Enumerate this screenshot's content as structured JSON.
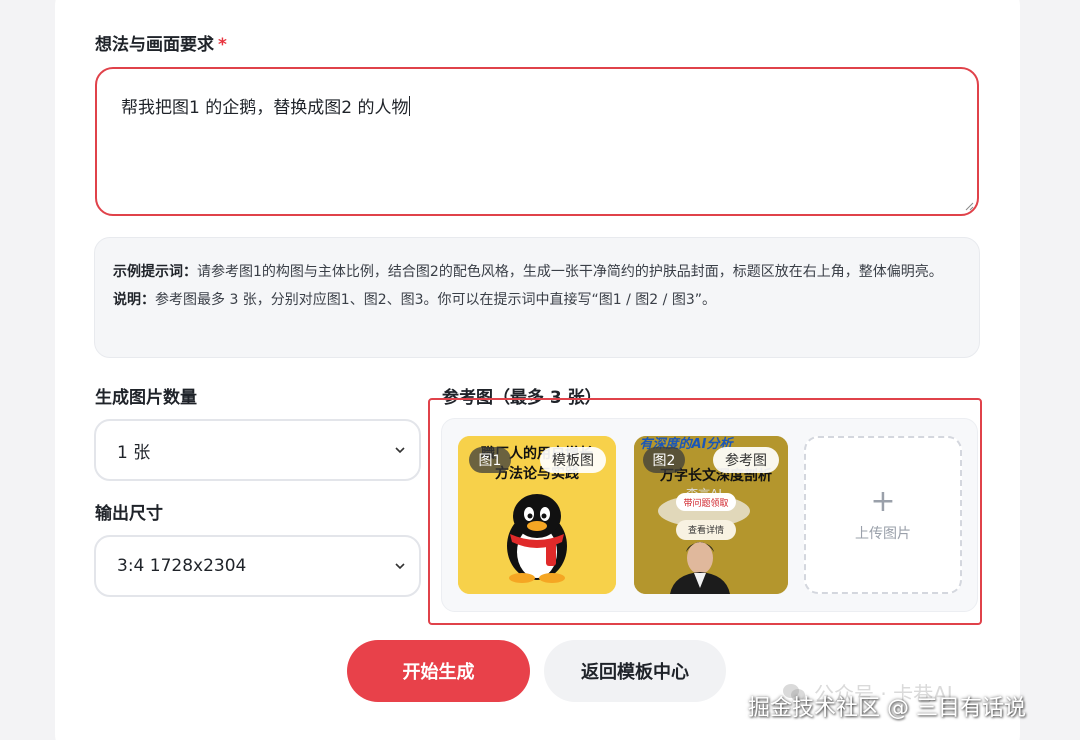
{
  "prompt_section": {
    "label": "想法与画面要求",
    "required_mark": "*",
    "value": "帮我把图1 的企鹅，替换成图2 的人物"
  },
  "hint": {
    "example_label": "示例提示词：",
    "example_text": "请参考图1的构图与主体比例，结合图2的配色风格，生成一张干净简约的护肤品封面，标题区放在右上角，整体偏明亮。",
    "note_label": "说明：",
    "note_text": "参考图最多 3 张，分别对应图1、图2、图3。你可以在提示词中直接写“图1 / 图2 / 图3”。"
  },
  "count_section": {
    "label": "生成图片数量",
    "selected": "1 张"
  },
  "size_section": {
    "label": "输出尺寸",
    "selected": "3:4 1728x2304"
  },
  "reference_section": {
    "label": "参考图（最多 3 张）",
    "images": [
      {
        "num_tag": "图1",
        "type_tag": "模板图",
        "caption_line1": "職厂人的用户增长",
        "caption_line2": "方法论与实践"
      },
      {
        "num_tag": "图2",
        "type_tag": "参考图",
        "caption_line1": "有深度的AI分析",
        "caption_line2": "万字长文深度剖析",
        "caption_line3": "李言AI",
        "badge1": "带问题领取",
        "badge2": "查看详情"
      }
    ],
    "upload_label": "上传图片"
  },
  "actions": {
    "start": "开始生成",
    "back": "返回模板中心"
  },
  "watermark": {
    "wechat": "公众号 · 卡巷AI",
    "main": "掘金技术社区 @ 三目有话说"
  }
}
